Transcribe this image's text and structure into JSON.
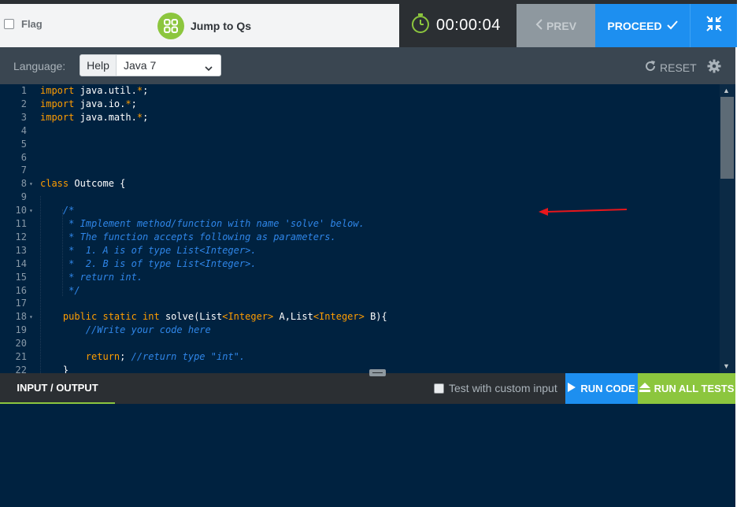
{
  "header": {
    "flag_label": "Flag",
    "jump_label": "Jump to Qs",
    "timer": "00:00:04",
    "prev_label": "PREV",
    "proceed_label": "PROCEED",
    "icons": [
      "checkbox-icon",
      "grid-icon",
      "stopwatch-icon",
      "chevron-left-icon",
      "check-icon",
      "collapse-icon"
    ]
  },
  "toolbar": {
    "language_label": "Language:",
    "help_label": "Help",
    "language_selected": "Java 7",
    "reset_label": "RESET"
  },
  "editor": {
    "lines": [
      {
        "num": "1",
        "fold": "",
        "segs": [
          {
            "t": "import",
            "c": "kw"
          },
          {
            "t": " java.util.",
            "c": ""
          },
          {
            "t": "*",
            "c": "kw"
          },
          {
            "t": ";",
            "c": ""
          }
        ]
      },
      {
        "num": "2",
        "fold": "",
        "segs": [
          {
            "t": "import",
            "c": "kw"
          },
          {
            "t": " java.io.",
            "c": ""
          },
          {
            "t": "*",
            "c": "kw"
          },
          {
            "t": ";",
            "c": ""
          }
        ]
      },
      {
        "num": "3",
        "fold": "",
        "segs": [
          {
            "t": "import",
            "c": "kw"
          },
          {
            "t": " java.math.",
            "c": ""
          },
          {
            "t": "*",
            "c": "kw"
          },
          {
            "t": ";",
            "c": ""
          }
        ]
      },
      {
        "num": "4",
        "fold": "",
        "segs": []
      },
      {
        "num": "5",
        "fold": "",
        "segs": []
      },
      {
        "num": "6",
        "fold": "",
        "segs": []
      },
      {
        "num": "7",
        "fold": "",
        "segs": []
      },
      {
        "num": "8",
        "fold": "▾",
        "segs": [
          {
            "t": "class",
            "c": "kw"
          },
          {
            "t": " Outcome {",
            "c": ""
          }
        ]
      },
      {
        "num": "9",
        "fold": "",
        "segs": []
      },
      {
        "num": "10",
        "fold": "▾",
        "segs": [
          {
            "t": "    ",
            "c": ""
          },
          {
            "t": "/*",
            "c": "cm"
          }
        ]
      },
      {
        "num": "11",
        "fold": "",
        "segs": [
          {
            "t": "     * Implement method/function with name 'solve' below.",
            "c": "cm"
          }
        ]
      },
      {
        "num": "12",
        "fold": "",
        "segs": [
          {
            "t": "     * The function accepts following as parameters.",
            "c": "cm"
          }
        ]
      },
      {
        "num": "13",
        "fold": "",
        "segs": [
          {
            "t": "     *  1. A is of type List<Integer>.",
            "c": "cm"
          }
        ]
      },
      {
        "num": "14",
        "fold": "",
        "segs": [
          {
            "t": "     *  2. B is of type List<Integer>.",
            "c": "cm"
          }
        ]
      },
      {
        "num": "15",
        "fold": "",
        "segs": [
          {
            "t": "     * return int.",
            "c": "cm"
          }
        ]
      },
      {
        "num": "16",
        "fold": "",
        "segs": [
          {
            "t": "     */",
            "c": "cm"
          }
        ]
      },
      {
        "num": "17",
        "fold": "",
        "segs": []
      },
      {
        "num": "18",
        "fold": "▾",
        "segs": [
          {
            "t": "    ",
            "c": ""
          },
          {
            "t": "public static int",
            "c": "kw"
          },
          {
            "t": " solve(List",
            "c": ""
          },
          {
            "t": "<Integer>",
            "c": "ty"
          },
          {
            "t": " A,List",
            "c": ""
          },
          {
            "t": "<Integer>",
            "c": "ty"
          },
          {
            "t": " B){",
            "c": ""
          }
        ]
      },
      {
        "num": "19",
        "fold": "",
        "segs": [
          {
            "t": "        ",
            "c": ""
          },
          {
            "t": "//Write your code here",
            "c": "cm"
          }
        ]
      },
      {
        "num": "20",
        "fold": "",
        "segs": []
      },
      {
        "num": "21",
        "fold": "",
        "segs": [
          {
            "t": "        ",
            "c": ""
          },
          {
            "t": "return",
            "c": "kw"
          },
          {
            "t": "; ",
            "c": ""
          },
          {
            "t": "//return type \"int\".",
            "c": "cm"
          }
        ]
      },
      {
        "num": "22",
        "fold": "",
        "segs": [
          {
            "t": "    }",
            "c": ""
          }
        ]
      }
    ]
  },
  "bottom": {
    "io_tab": "INPUT / OUTPUT",
    "custom_input_label": "Test with custom input",
    "run_code": "RUN CODE",
    "run_all": "RUN ALL TESTS"
  },
  "colors": {
    "editor_bg": "#002240",
    "accent_blue": "#1d8ff0",
    "accent_green": "#8cc63e",
    "annotation_arrow": "#e8161b"
  }
}
